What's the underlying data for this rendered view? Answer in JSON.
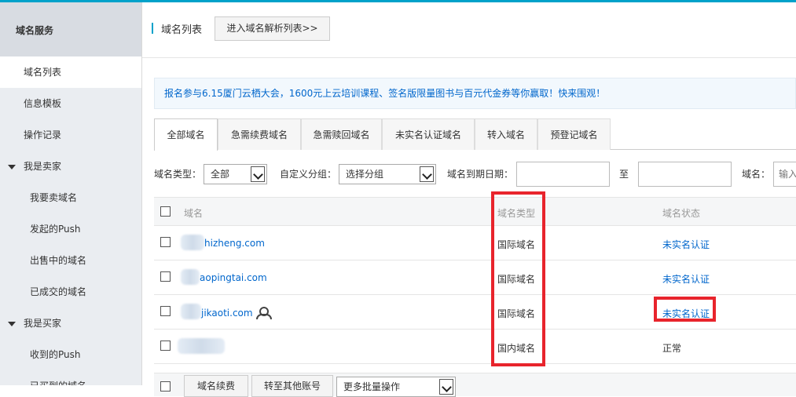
{
  "sidebar": {
    "header": "域名服务",
    "items": [
      {
        "label": "域名列表",
        "active": true
      },
      {
        "label": "信息模板"
      },
      {
        "label": "操作记录"
      }
    ],
    "seller_group": "我是卖家",
    "seller_items": [
      "我要卖域名",
      "发起的Push",
      "出售中的域名",
      "已成交的域名"
    ],
    "buyer_group": "我是买家",
    "buyer_items": [
      "收到的Push",
      "已买到的域名"
    ]
  },
  "header": {
    "title": "域名列表",
    "goto_button": "进入域名解析列表>>"
  },
  "notice": "报名参与6.15厦门云栖大会，1600元上云培训课程、签名版限量图书与百元代金券等你赢取！快来围观！",
  "tabs": [
    "全部域名",
    "急需续费域名",
    "急需赎回域名",
    "未实名认证域名",
    "转入域名",
    "预登记域名"
  ],
  "filters": {
    "type_label": "域名类型：",
    "type_value": "全部",
    "group_label": "自定义分组：",
    "group_value": "选择分组",
    "expire_label": "域名到期日期：",
    "to_label": "至",
    "domain_label": "域名：",
    "domain_placeholder": "输入"
  },
  "table": {
    "headers": {
      "domain": "域名",
      "type": "域名类型",
      "status": "域名状态"
    },
    "rows": [
      {
        "domain": "hizheng.com",
        "type": "国际域名",
        "status": "未实名认证",
        "status_link": true
      },
      {
        "domain": "aopingtai.com",
        "type": "国际域名",
        "status": "未实名认证",
        "status_link": true
      },
      {
        "domain": "jikaoti.com",
        "type": "国际域名",
        "status": "未实名认证",
        "status_link": true
      },
      {
        "domain": "",
        "type": "国内域名",
        "status": "正常",
        "status_link": false
      }
    ]
  },
  "footer": {
    "renew_button": "域名续费",
    "transfer_button": "转至其他账号",
    "more_select": "更多批量操作"
  },
  "colors": {
    "accent": "#00a2ca",
    "link": "#0066cc",
    "highlight": "#e8242c"
  }
}
